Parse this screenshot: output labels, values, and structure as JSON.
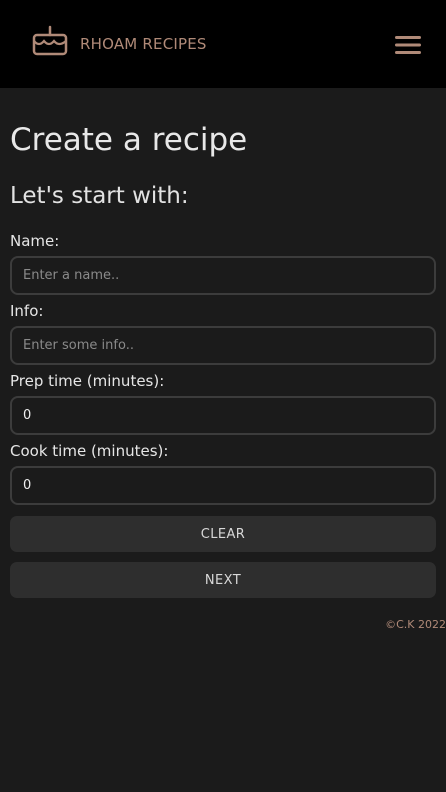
{
  "header": {
    "brand": "RHOAM RECIPES",
    "logo_icon": "cake-icon",
    "menu_icon": "hamburger-menu-icon"
  },
  "main": {
    "title": "Create a recipe",
    "subtitle": "Let's start with:",
    "fields": {
      "name": {
        "label": "Name:",
        "placeholder": "Enter a name..",
        "value": ""
      },
      "info": {
        "label": "Info:",
        "placeholder": "Enter some info..",
        "value": ""
      },
      "prep_time": {
        "label": "Prep time (minutes):",
        "value": "0"
      },
      "cook_time": {
        "label": "Cook time (minutes):",
        "value": "0"
      }
    },
    "buttons": {
      "clear": "CLEAR",
      "next": "NEXT"
    }
  },
  "footer": {
    "copyright": "©C.K 2022"
  },
  "colors": {
    "accent": "#b08a78",
    "background": "#1b1b1b",
    "header_bg": "#000000",
    "button_bg": "#2e2e2e",
    "field_border": "#3c3c3c"
  }
}
